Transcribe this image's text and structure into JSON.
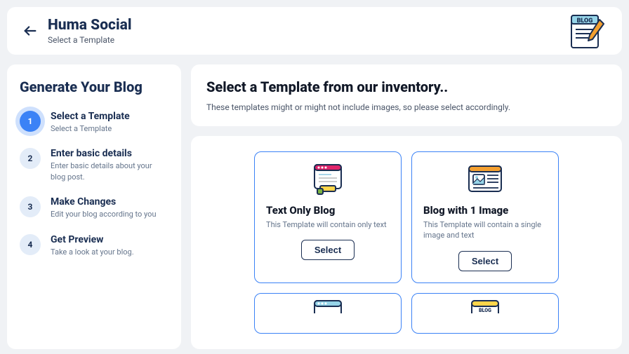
{
  "header": {
    "title": "Huma Social",
    "subtitle": "Select a Template"
  },
  "sidebar": {
    "title": "Generate Your Blog",
    "steps": [
      {
        "num": "1",
        "title": "Select a Template",
        "desc": "Select a Template"
      },
      {
        "num": "2",
        "title": "Enter basic details",
        "desc": "Enter basic details about your blog post."
      },
      {
        "num": "3",
        "title": "Make Changes",
        "desc": "Edit your blog according to you"
      },
      {
        "num": "4",
        "title": "Get Preview",
        "desc": "Take a look at your blog."
      }
    ]
  },
  "main": {
    "title": "Select a Template from our inventory..",
    "subtitle": "These templates might or might not include images, so please select accordingly."
  },
  "templates": [
    {
      "title": "Text Only Blog",
      "desc": "This Template will contain only text",
      "button": "Select"
    },
    {
      "title": "Blog with 1 Image",
      "desc": "This Template will contain a single image and text",
      "button": "Select"
    }
  ]
}
